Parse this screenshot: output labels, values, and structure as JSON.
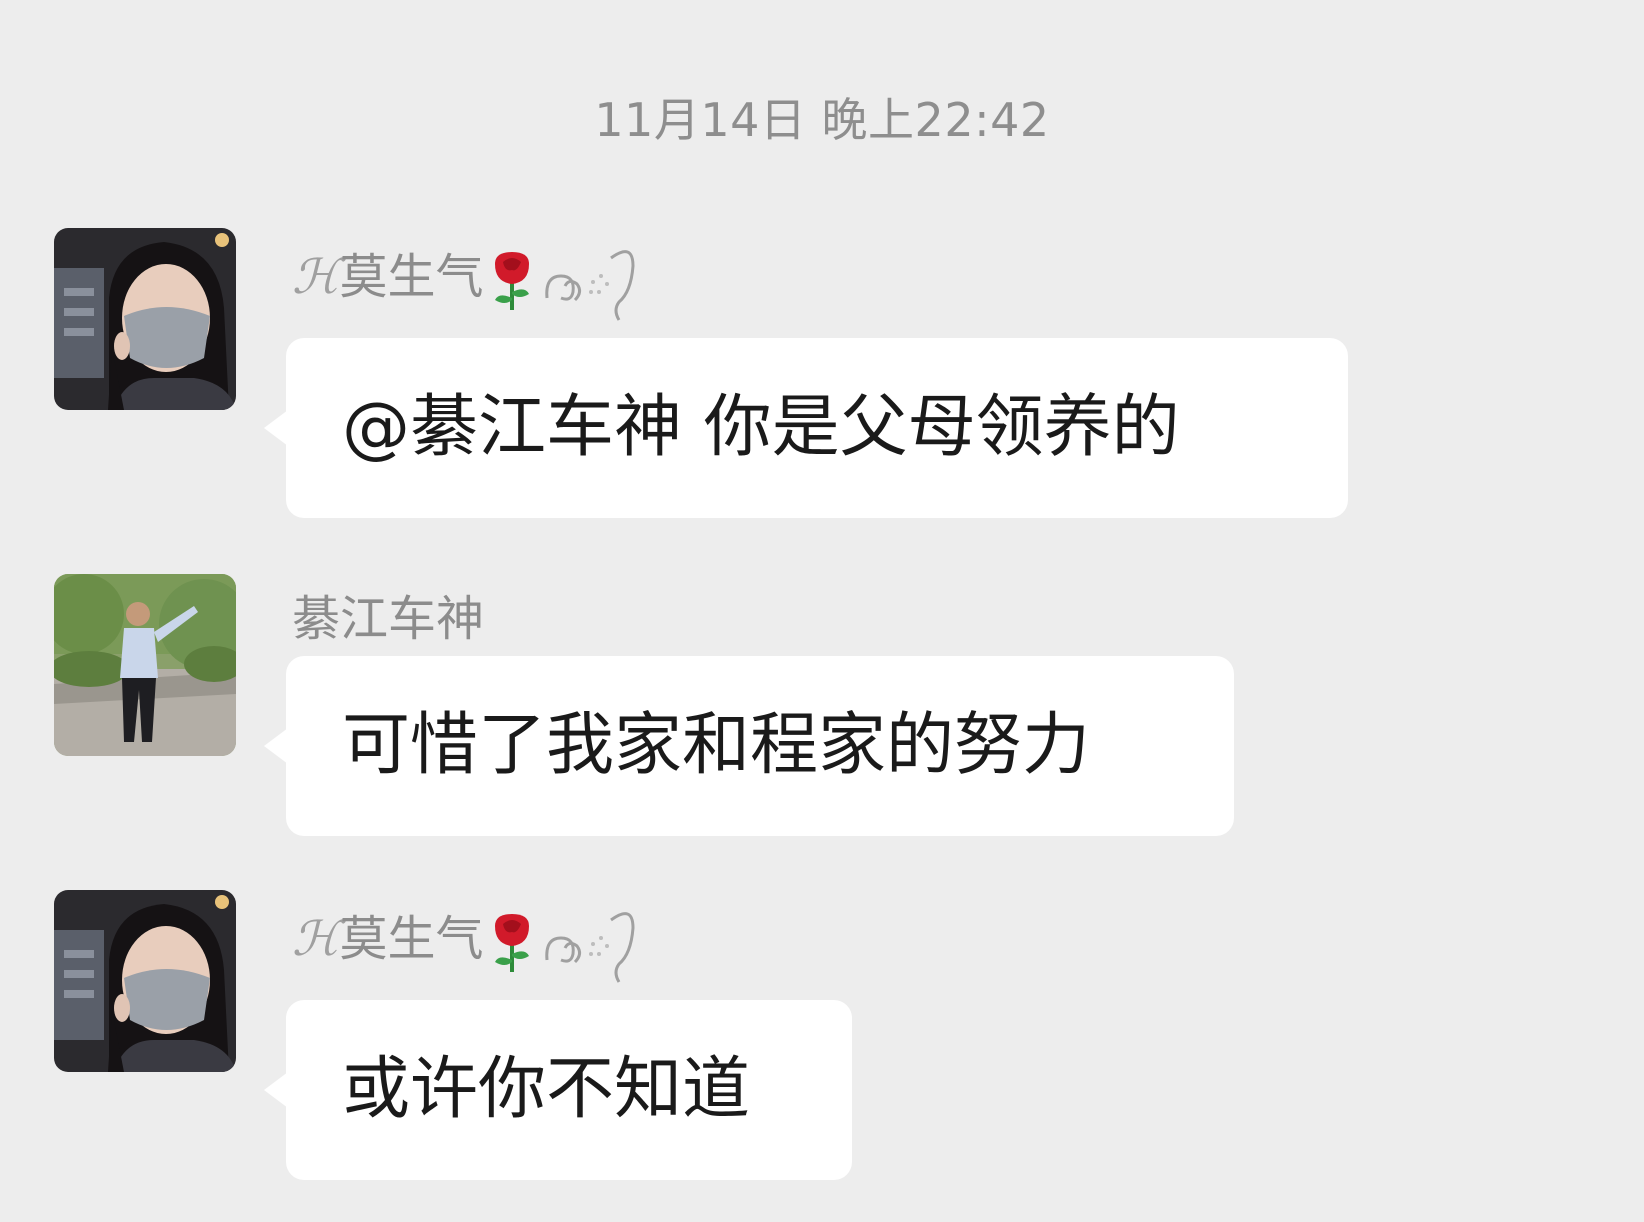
{
  "chat": {
    "timestamp": "11月14日 晚上22:42",
    "messages": [
      {
        "sender": {
          "prefix": "ℋ",
          "name": "莫生气",
          "emoji": "rose-icon",
          "suffix_deco": "swirl-icon"
        },
        "avatar": "woman-with-mask-avatar",
        "text": "@綦江车神  你是父母领养的"
      },
      {
        "sender": {
          "name": "綦江车神"
        },
        "avatar": "man-waving-avatar",
        "text": "可惜了我家和程家的努力"
      },
      {
        "sender": {
          "prefix": "ℋ",
          "name": "莫生气",
          "emoji": "rose-icon",
          "suffix_deco": "swirl-icon"
        },
        "avatar": "woman-with-mask-avatar",
        "text": "或许你不知道"
      }
    ]
  },
  "colors": {
    "background": "#ededed",
    "bubble": "#ffffff",
    "sender_text": "#8c8c8c",
    "timestamp_text": "#8e8e8e",
    "message_text": "#1a1a1a"
  }
}
